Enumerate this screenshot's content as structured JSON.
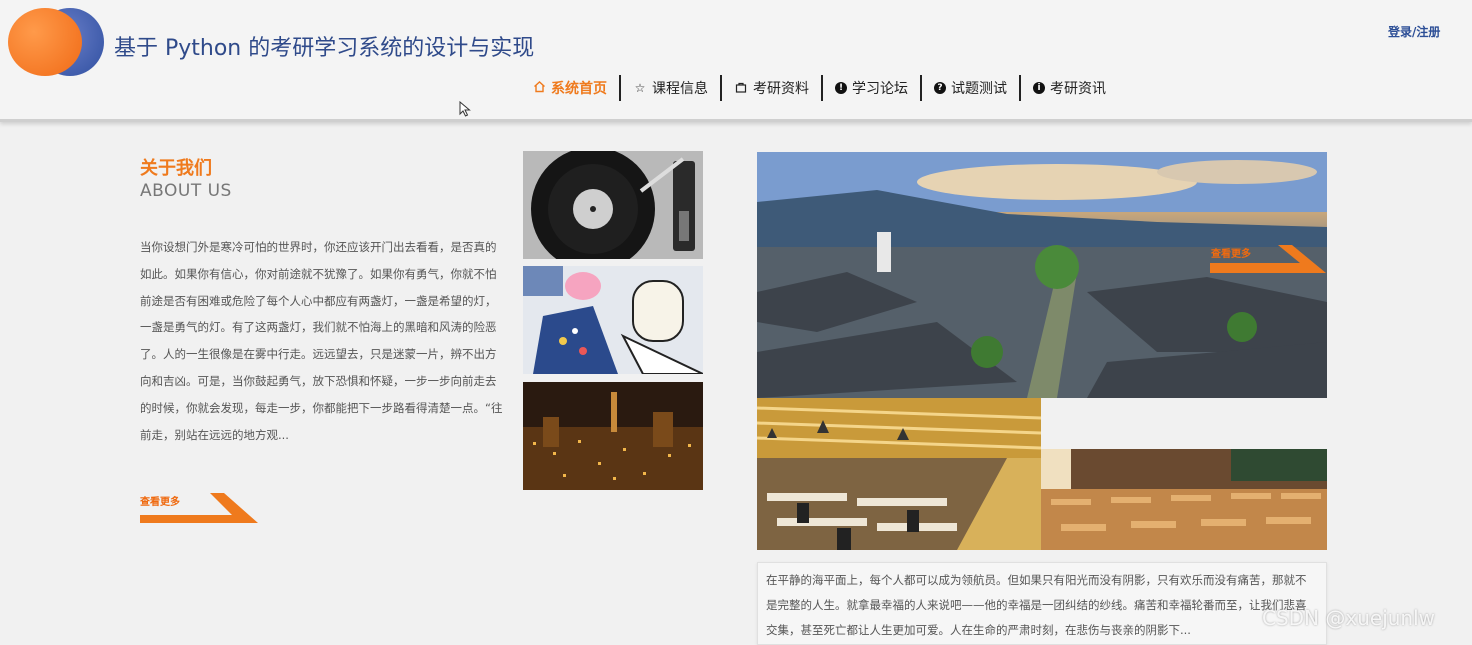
{
  "header": {
    "site_title": "基于 Python 的考研学习系统的设计与实现",
    "login_label": "登录/注册"
  },
  "nav": {
    "items": [
      {
        "label": "系统首页",
        "icon": "home-icon",
        "active": true
      },
      {
        "label": "课程信息",
        "icon": "star-icon"
      },
      {
        "label": "考研资料",
        "icon": "bag-icon"
      },
      {
        "label": "学习论坛",
        "icon": "info-icon"
      },
      {
        "label": "试题测试",
        "icon": "question-icon"
      },
      {
        "label": "考研资讯",
        "icon": "info-icon"
      }
    ]
  },
  "about": {
    "title": "关于我们",
    "subtitle": "ABOUT US",
    "text": "当你设想门外是寒冷可怕的世界时，你还应该开门出去看看，是否真的如此。如果你有信心，你对前途就不犹豫了。如果你有勇气，你就不怕前途是否有困难或危险了每个人心中都应有两盏灯，一盏是希望的灯，一盏是勇气的灯。有了这两盏灯，我们就不怕海上的黑暗和风涛的险恶了。人的一生很像是在雾中行走。远远望去，只是迷蒙一片，辨不出方向和吉凶。可是，当你鼓起勇气，放下恐惧和怀疑，一步一步向前走去的时候，你就会发现，每走一步，你都能把下一步路看得清楚一点。“往前走，别站在远远的地方观...",
    "more_label": "查看更多"
  },
  "gallery": {
    "more_label": "查看更多",
    "caption": "在平静的海平面上，每个人都可以成为领航员。但如果只有阳光而没有阴影，只有欢乐而没有痛苦，那就不是完整的人生。就拿最幸福的人来说吧——他的幸福是一团纠结的纱线。痛苦和幸福轮番而至，让我们悲喜交集，甚至死亡都让人生更加可爱。人在生命的严肃时刻，在悲伤与丧亲的阴影下..."
  },
  "watermark": "CSDN @xuejunlw",
  "colors": {
    "accent": "#ef7a1d",
    "title_blue": "#2f4a8a"
  }
}
